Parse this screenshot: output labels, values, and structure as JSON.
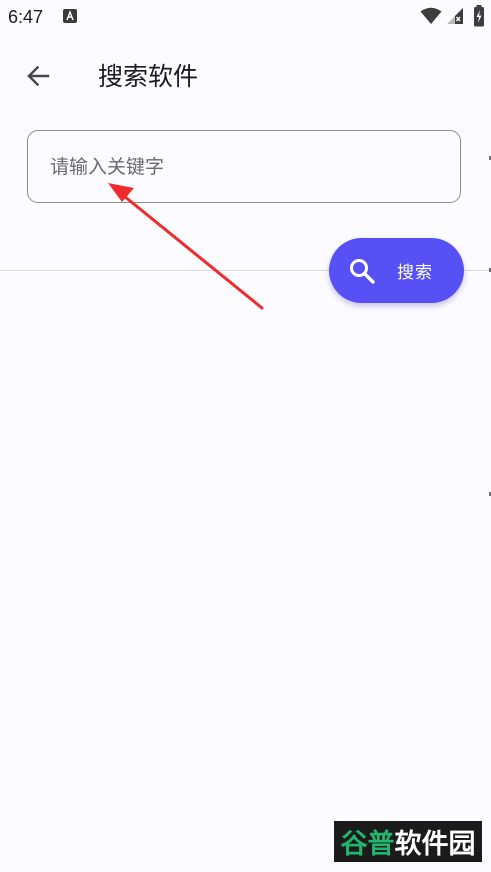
{
  "status_bar": {
    "time": "6:47"
  },
  "app_bar": {
    "title": "搜索软件"
  },
  "search": {
    "placeholder": "请输入关键字",
    "value": ""
  },
  "fab": {
    "label": "搜索"
  },
  "watermark": {
    "part1": "谷普",
    "part2": "软件园"
  },
  "colors": {
    "accent": "#5750f5",
    "annotation": "#f02b2b"
  }
}
